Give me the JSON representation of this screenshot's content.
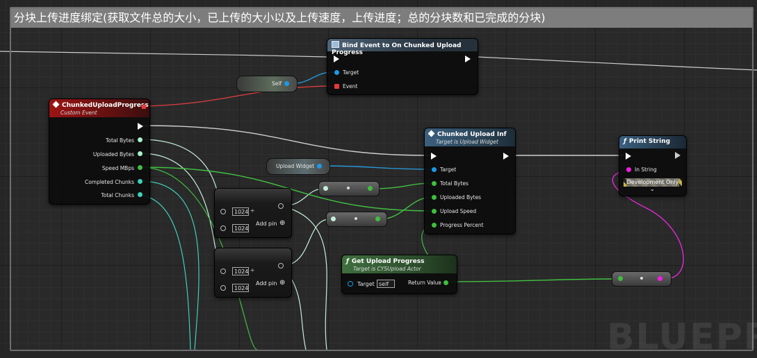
{
  "comment": {
    "title": "分块上传进度绑定(获取文件总的大小，已上传的大小以及上传速度，上传进度；总的分块数和已完成的分块)"
  },
  "nodes": {
    "bind_event": {
      "title": "Bind Event to On Chunked Upload Progress",
      "pins": {
        "target": "Target",
        "event": "Event"
      }
    },
    "self_ref": {
      "label": "Self"
    },
    "custom_event": {
      "title": "ChunkedUploadProgress",
      "subtitle": "Custom Event",
      "pins": {
        "total_bytes": "Total Bytes",
        "uploaded_bytes": "Uploaded Bytes",
        "speed": "Speed MBps",
        "completed_chunks": "Completed Chunks",
        "total_chunks": "Total Chunks"
      }
    },
    "chunked_upload_inf": {
      "title": "Chunked Upload Inf",
      "subtitle": "Target is Upload Widget",
      "pins": {
        "target": "Target",
        "total_bytes": "Total Bytes",
        "uploaded_bytes": "Uploaded Bytes",
        "upload_speed": "Upload Speed",
        "progress_percent": "Progress Percent"
      }
    },
    "upload_widget": {
      "label": "Upload Widget"
    },
    "print_string": {
      "title": "Print String",
      "pins": {
        "in_string": "In String"
      },
      "dev_only": "Development Only"
    },
    "divide1": {
      "a": "1024",
      "b": "1024",
      "add_pin": "Add pin"
    },
    "divide2": {
      "a": "1024",
      "b": "1024",
      "add_pin": "Add pin"
    },
    "get_upload_progress": {
      "title": "Get Upload Progress",
      "subtitle": "Target is CYSUpload Actor",
      "pins": {
        "target": "Target",
        "target_value": "self",
        "return_value": "Return Value"
      }
    }
  },
  "watermark": "BLUEPRI",
  "colors": {
    "exec": "#ffffff",
    "float": "#a8f0d0",
    "int64": "#a8f0d0",
    "object": "#1b9ae8",
    "delegate": "#e63a3a",
    "string": "#f21ee0",
    "bool": "#3fbe3f"
  }
}
